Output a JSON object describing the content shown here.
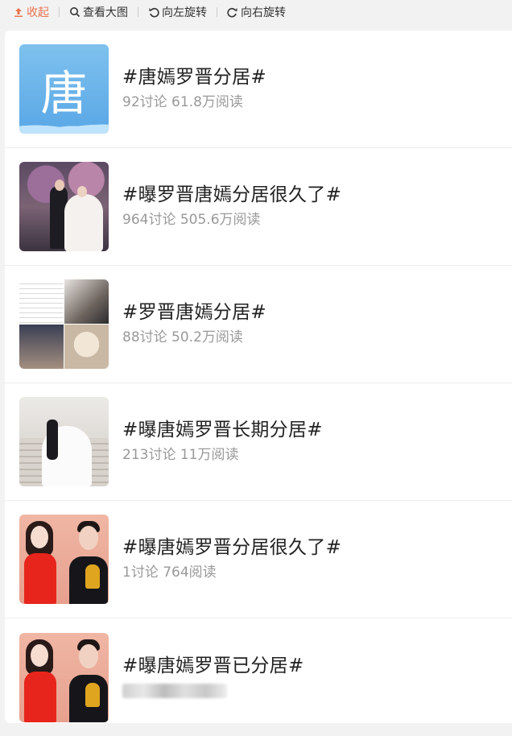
{
  "toolbar": {
    "collapse": "收起",
    "view_large": "查看大图",
    "rotate_left": "向左旋转",
    "rotate_right": "向右旋转"
  },
  "colors": {
    "accent": "#eb7350",
    "meta": "#999999",
    "title": "#222222"
  },
  "topics": [
    {
      "title": "#唐嫣罗晋分居#",
      "meta": "92讨论 61.8万阅读",
      "thumb_letter": "唐"
    },
    {
      "title": "#曝罗晋唐嫣分居很久了#",
      "meta": "964讨论 505.6万阅读"
    },
    {
      "title": "#罗晋唐嫣分居#",
      "meta": "88讨论 50.2万阅读"
    },
    {
      "title": "#曝唐嫣罗晋长期分居#",
      "meta": "213讨论 11万阅读"
    },
    {
      "title": "#曝唐嫣罗晋分居很久了#",
      "meta": "1讨论 764阅读"
    },
    {
      "title": "#曝唐嫣罗晋已分居#",
      "meta": ""
    }
  ]
}
